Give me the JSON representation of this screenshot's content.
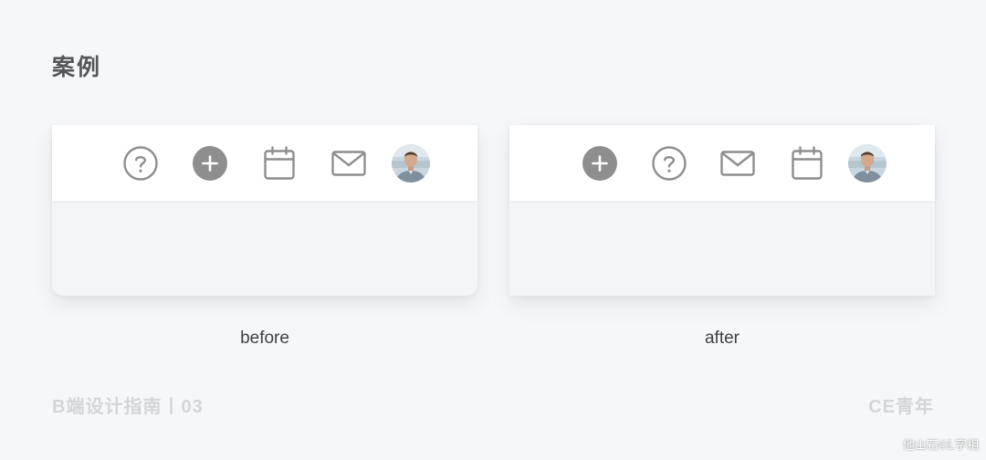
{
  "page": {
    "title": "案例",
    "footer_left": "B端设计指南丨03",
    "footer_right": "CE青年",
    "watermark": "他山石©𝕃字相"
  },
  "examples": [
    {
      "caption": "before",
      "toolbar_icons": [
        "help-icon",
        "add-icon",
        "calendar-icon",
        "mail-icon",
        "user-avatar"
      ]
    },
    {
      "caption": "after",
      "toolbar_icons": [
        "add-icon",
        "help-icon",
        "mail-icon",
        "calendar-icon",
        "user-avatar"
      ]
    }
  ],
  "colors": {
    "background": "#f6f7f9",
    "icon": "#8e8e8e",
    "title": "#555659",
    "footer": "#d3d5da"
  }
}
